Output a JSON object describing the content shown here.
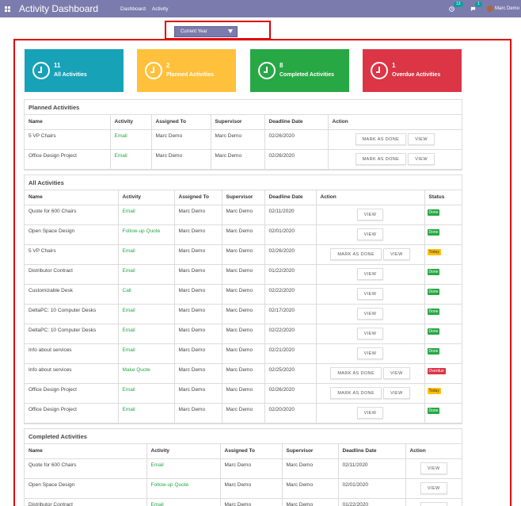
{
  "navbar": {
    "title": "Activity Dashboard",
    "menu": [
      "Dashboard",
      "Activity"
    ],
    "activity_count": "13",
    "message_count": "1",
    "user_name": "Marc Demo"
  },
  "filter": {
    "selected": "Current Year"
  },
  "cards": [
    {
      "count": "11",
      "label": "All Activities",
      "color": "#17a2b8"
    },
    {
      "count": "2",
      "label": "Planned Activities",
      "color": "#ffc13b"
    },
    {
      "count": "8",
      "label": "Completed Activities",
      "color": "#28a745"
    },
    {
      "count": "1",
      "label": "Overdue Activities",
      "color": "#dc3545"
    }
  ],
  "buttons": {
    "mark_done": "MARK AS DONE",
    "view": "VIEW"
  },
  "planned": {
    "title": "Planned Activities",
    "columns": [
      "Name",
      "Activity",
      "Assigned To",
      "Supervisor",
      "Deadline Date",
      "Action"
    ],
    "rows": [
      {
        "name": "5 VP Chairs",
        "activity": "Email",
        "assigned": "Marc Demo",
        "supervisor": "Marc Demo",
        "deadline": "02/26/2020"
      },
      {
        "name": "Office Design Project",
        "activity": "Email",
        "assigned": "Marc Demo",
        "supervisor": "Marc Demo",
        "deadline": "02/26/2020"
      }
    ]
  },
  "all": {
    "title": "All Activities",
    "columns": [
      "Name",
      "Activity",
      "Assigned To",
      "Supervisor",
      "Deadline Date",
      "Action",
      "Status"
    ],
    "rows": [
      {
        "name": "Quote for 600 Chairs",
        "activity": "Email",
        "assigned": "Marc Demo",
        "supervisor": "Marc Demo",
        "deadline": "02/11/2020",
        "mark": false,
        "status": "Done"
      },
      {
        "name": "Open Space Design",
        "activity": "Follow-up Quote",
        "assigned": "Marc Demo",
        "supervisor": "Marc Demo",
        "deadline": "02/01/2020",
        "mark": false,
        "status": "Done"
      },
      {
        "name": "5 VP Chairs",
        "activity": "Email",
        "assigned": "Marc Demo",
        "supervisor": "Marc Demo",
        "deadline": "02/26/2020",
        "mark": true,
        "status": "Today"
      },
      {
        "name": "Distributor Contract",
        "activity": "Email",
        "assigned": "Marc Demo",
        "supervisor": "Marc Demo",
        "deadline": "01/22/2020",
        "mark": false,
        "status": "Done"
      },
      {
        "name": "Customizable Desk",
        "activity": "Call",
        "assigned": "Marc Demo",
        "supervisor": "Marc Demo",
        "deadline": "02/22/2020",
        "mark": false,
        "status": "Done"
      },
      {
        "name": "DeltaPC: 10 Computer Desks",
        "activity": "Email",
        "assigned": "Marc Demo",
        "supervisor": "Marc Demo",
        "deadline": "02/17/2020",
        "mark": false,
        "status": "Done"
      },
      {
        "name": "DeltaPC: 10 Computer Desks",
        "activity": "Email",
        "assigned": "Marc Demo",
        "supervisor": "Marc Demo",
        "deadline": "02/22/2020",
        "mark": false,
        "status": "Done"
      },
      {
        "name": "Info about services",
        "activity": "Email",
        "assigned": "Marc Demo",
        "supervisor": "Marc Demo",
        "deadline": "02/21/2020",
        "mark": false,
        "status": "Done"
      },
      {
        "name": "Info about services",
        "activity": "Make Quote",
        "assigned": "Marc Demo",
        "supervisor": "Marc Demo",
        "deadline": "02/25/2020",
        "mark": true,
        "status": "Overdue"
      },
      {
        "name": "Office Design Project",
        "activity": "Email",
        "assigned": "Marc Demo",
        "supervisor": "Marc Demo",
        "deadline": "02/26/2020",
        "mark": true,
        "status": "Today"
      },
      {
        "name": "Office Design Project",
        "activity": "Email",
        "assigned": "Marc Demo",
        "supervisor": "Marc Demo",
        "deadline": "02/20/2020",
        "mark": false,
        "status": "Done"
      }
    ]
  },
  "completed": {
    "title": "Completed Activities",
    "columns": [
      "Name",
      "Activity",
      "Assigned To",
      "Supervisor",
      "Deadline Date",
      "Action"
    ],
    "rows": [
      {
        "name": "Quote for 600 Chairs",
        "activity": "Email",
        "assigned": "Marc Demo",
        "supervisor": "Marc Demo",
        "deadline": "02/11/2020"
      },
      {
        "name": "Open Space Design",
        "activity": "Follow-up Quote",
        "assigned": "Marc Demo",
        "supervisor": "Marc Demo",
        "deadline": "02/01/2020"
      },
      {
        "name": "Distributor Contract",
        "activity": "Email",
        "assigned": "Marc Demo",
        "supervisor": "Marc Demo",
        "deadline": "01/22/2020"
      }
    ]
  }
}
